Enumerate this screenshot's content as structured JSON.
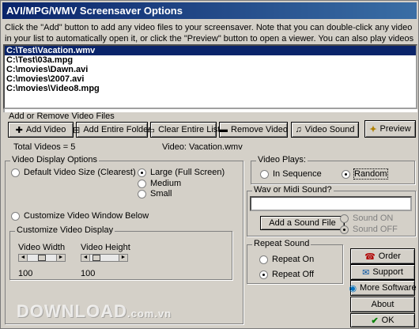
{
  "window": {
    "title": "AVI/MPG/WMV Screensaver Options"
  },
  "intro_text": "Click the \"Add\" button to add any video files to your screensaver. Note that you can double-click any video in your list to automatically open it, or click the \"Preview\" button to open a viewer. You can also play videos full-screen.",
  "files": [
    {
      "path": "C:\\Test\\Vacation.wmv",
      "selected": true
    },
    {
      "path": "C:\\Test\\03a.mpg",
      "selected": false
    },
    {
      "path": "C:\\movies\\Dawn.avi",
      "selected": false
    },
    {
      "path": "C:\\movies\\2007.avi",
      "selected": false
    },
    {
      "path": "C:\\movies\\Video8.mpg",
      "selected": false
    }
  ],
  "add_remove": {
    "heading": "Add or Remove Video Files",
    "buttons": {
      "add": "Add Video",
      "add_folder": "Add Entire Folder",
      "clear": "Clear Entire List",
      "remove": "Remove Video",
      "sound": "Video Sound",
      "preview": "Preview"
    },
    "total": "Total Videos = 5",
    "current": "Video: Vacation.wmv"
  },
  "display_options": {
    "legend": "Video Display Options",
    "default_size": "Default Video Size (Clearest)",
    "large": "Large (Full Screen)",
    "medium": "Medium",
    "small": "Small",
    "customize_radio": "Customize Video Window Below",
    "customize_legend": "Customize Video Display",
    "width_label": "Video Width",
    "height_label": "Video Height",
    "width_value": "100",
    "height_value": "100"
  },
  "video_plays": {
    "legend": "Video Plays:",
    "sequence": "In Sequence",
    "random": "Random"
  },
  "sound": {
    "legend": "Wav or Midi Sound?",
    "file_value": "",
    "add_button": "Add a Sound File",
    "on": "Sound ON",
    "off": "Sound OFF"
  },
  "repeat": {
    "legend": "Repeat Sound",
    "on": "Repeat On",
    "off": "Repeat Off"
  },
  "side_buttons": {
    "order": "Order",
    "support": "Support",
    "more": "More Software",
    "about": "About",
    "ok": "OK"
  },
  "watermark": {
    "main": "DOWNLOAD",
    "suffix": ".com.vn"
  },
  "colors": {
    "title_start": "#0a246a",
    "title_end": "#3a6ea5",
    "selection": "#0a246a",
    "face": "#d4d0c8"
  }
}
